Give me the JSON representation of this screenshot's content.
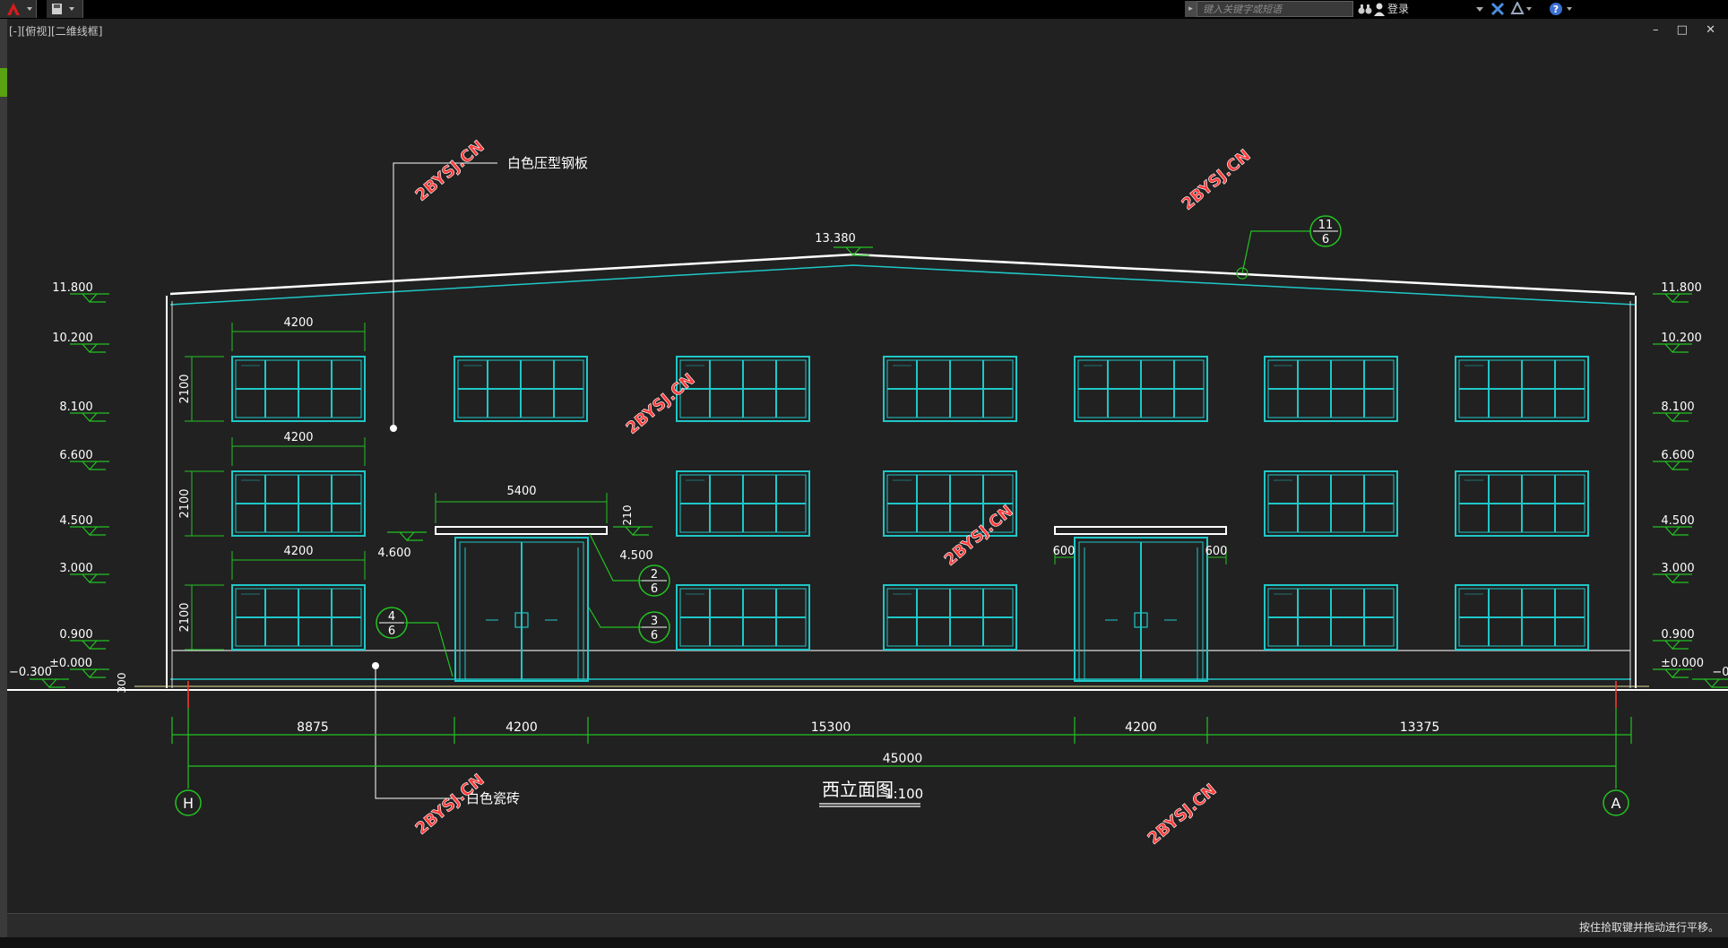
{
  "app": {
    "viewport_label": "[-][俯视][二维线框]",
    "search_placeholder": "键入关键字或短语",
    "login_label": "登录",
    "status_message": "按住拾取键并拖动进行平移。",
    "window_controls": "– □ ✕"
  },
  "drawing": {
    "title": "西立面图",
    "scale": "1:100",
    "ridge_level": "13.380",
    "levels_left": [
      "11.800",
      "10.200",
      "8.100",
      "6.600",
      "4.500",
      "3.000",
      "0.900",
      "±0.000",
      "−0.300"
    ],
    "levels_right": [
      "11.800",
      "10.200",
      "8.100",
      "6.600",
      "4.500",
      "3.000",
      "0.900",
      "±0.000",
      "−0"
    ],
    "window_widths": [
      "4200",
      "4200",
      "4200"
    ],
    "window_heights": [
      "2100",
      "2100",
      "2100"
    ],
    "canopy_width": "5400",
    "canopy_thickness": "210",
    "canopy_level_left": "4.600",
    "canopy_level_right": "4.500",
    "side_offsets": [
      "600",
      "600"
    ],
    "plinth_height": "300",
    "dim_segments": [
      "8875",
      "4200",
      "15300",
      "4200",
      "13375"
    ],
    "dim_total": "45000",
    "axis_left": "H",
    "axis_right": "A",
    "note_roof": "白色压型钢板",
    "note_base": "白色瓷砖",
    "callouts": [
      {
        "top": "11",
        "bottom": "6"
      },
      {
        "top": "2",
        "bottom": "6"
      },
      {
        "top": "3",
        "bottom": "6"
      },
      {
        "top": "4",
        "bottom": "6"
      }
    ],
    "watermark": "2BYSJ.CN"
  },
  "colors": {
    "cyan": "#1fc7c7",
    "green": "#22c322",
    "white": "#ffffff",
    "red": "#ff3030",
    "background": "#212121"
  }
}
